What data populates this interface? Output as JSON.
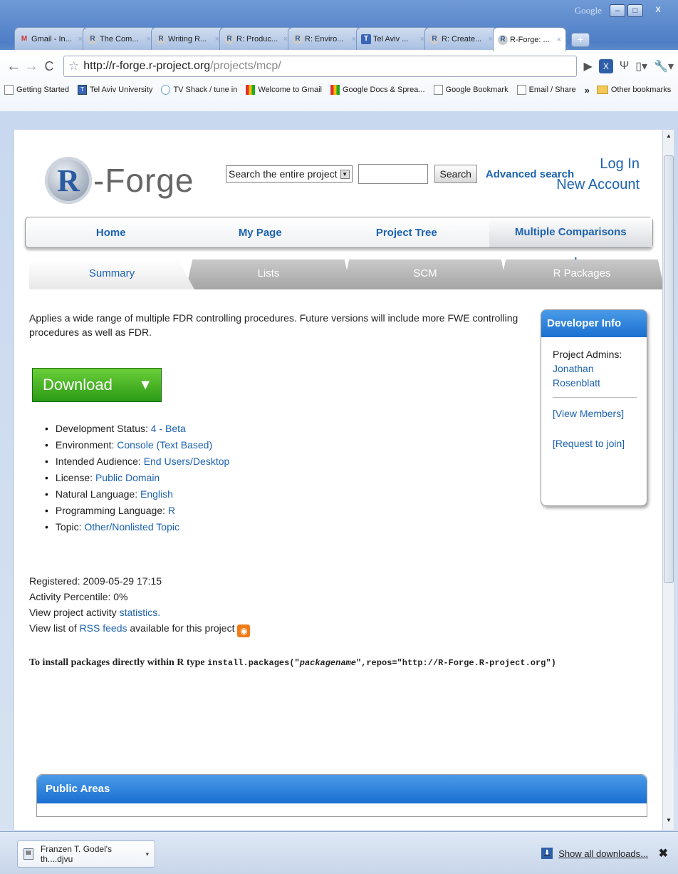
{
  "window": {
    "brand": "Google",
    "minimize": "–",
    "maximize": "□",
    "close": "X"
  },
  "tabs": [
    {
      "label": "Gmail - In...",
      "icon": "gmail-icon"
    },
    {
      "label": "The Com...",
      "icon": "r-icon"
    },
    {
      "label": "Writing R...",
      "icon": "r-icon"
    },
    {
      "label": "R: Produc...",
      "icon": "r-icon"
    },
    {
      "label": "R: Enviro...",
      "icon": "r-icon"
    },
    {
      "label": "Tel Aviv ...",
      "icon": "university-icon"
    },
    {
      "label": "R: Create...",
      "icon": "r-icon"
    },
    {
      "label": "R-Forge: ...",
      "icon": "r-icon"
    }
  ],
  "tab_close": "×",
  "url": {
    "domain": "http://r-forge.r-project.org",
    "path": "/projects/mcp/"
  },
  "bookmarks": [
    {
      "label": "Getting Started",
      "icon": "page"
    },
    {
      "label": "Tel Aviv University",
      "icon": "uni"
    },
    {
      "label": "TV Shack / tune in",
      "icon": "tv"
    },
    {
      "label": "Welcome to Gmail",
      "icon": "gm"
    },
    {
      "label": "Google Docs & Sprea...",
      "icon": "gm"
    },
    {
      "label": "Google Bookmark",
      "icon": "page"
    },
    {
      "label": "Email / Share",
      "icon": "page"
    }
  ],
  "bookmarks_more": "»",
  "other_bookmarks": "Other bookmarks",
  "site": {
    "logo_text": "-Forge",
    "logo_r": "R",
    "search_scope": "Search the entire project",
    "search_button": "Search",
    "advanced_search": "Advanced search",
    "login": "Log In",
    "new_account": "New Account",
    "nav": [
      "Home",
      "My Page",
      "Project Tree",
      "Multiple Comparisons procedures"
    ],
    "subtabs": [
      "Summary",
      "Lists",
      "SCM",
      "R Packages"
    ]
  },
  "project": {
    "description": "Applies a wide range of multiple FDR controlling procedures. Future versions will include more FWE controlling procedures as well as FDR.",
    "download": "Download",
    "traits": [
      {
        "label": "Development Status:",
        "value": "4 - Beta"
      },
      {
        "label": "Environment:",
        "value": "Console (Text Based)"
      },
      {
        "label": "Intended Audience:",
        "value": "End Users/Desktop"
      },
      {
        "label": "License:",
        "value": "Public Domain"
      },
      {
        "label": "Natural Language:",
        "value": "English"
      },
      {
        "label": "Programming Language:",
        "value": "R"
      },
      {
        "label": "Topic:",
        "value": "Other/Nonlisted Topic"
      }
    ],
    "registered": "Registered: 2009-05-29 17:15",
    "activity": "Activity Percentile: 0%",
    "stats_prefix": "View project activity",
    "stats_link": "statistics.",
    "rss_prefix": "View list of",
    "rss_link": "RSS feeds",
    "rss_suffix": "available for this project",
    "install_prefix": "To install packages directly within R type",
    "install_code_1": "install.packages(\"",
    "install_code_pkg": "packagename",
    "install_code_2": "\",repos=\"http://R-Forge.R-project.org\")"
  },
  "developer": {
    "title": "Developer Info",
    "admins_label": "Project Admins:",
    "admin": "Jonathan Rosenblatt",
    "view_members": "[View Members]",
    "request_join": "[Request to join]"
  },
  "public_areas": {
    "title": "Public Areas"
  },
  "downloads": {
    "file": "Franzen T. Godel's th....djvu",
    "show_all": "Show all downloads...",
    "close": "✖"
  }
}
